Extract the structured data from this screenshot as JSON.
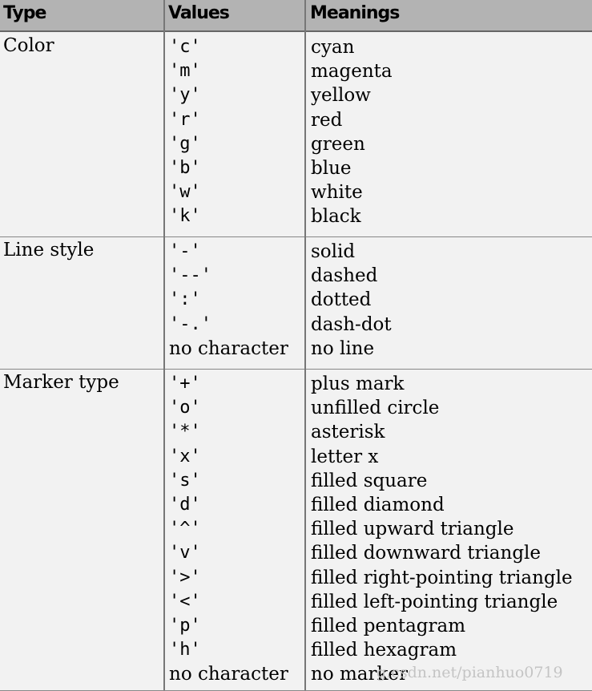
{
  "headers": {
    "type": "Type",
    "values": "Values",
    "meanings": "Meanings"
  },
  "sections": [
    {
      "type": "Color",
      "rows": [
        [
          "'c'",
          "cyan"
        ],
        [
          "'m'",
          "magenta"
        ],
        [
          "'y'",
          "yellow"
        ],
        [
          "'r'",
          "red"
        ],
        [
          "'g'",
          "green"
        ],
        [
          "'b'",
          "blue"
        ],
        [
          "'w'",
          "white"
        ],
        [
          "'k'",
          "black"
        ]
      ]
    },
    {
      "type": "Line style",
      "rows": [
        [
          "'-'",
          "solid"
        ],
        [
          "'--'",
          "dashed"
        ],
        [
          "':'",
          "dotted"
        ],
        [
          "'-.'",
          "dash-dot"
        ],
        [
          "no character",
          "no line"
        ]
      ]
    },
    {
      "type": "Marker type",
      "rows": [
        [
          "'+'",
          "plus mark"
        ],
        [
          "'o'",
          "unfilled circle"
        ],
        [
          "'*'",
          "asterisk"
        ],
        [
          "'x'",
          "letter x"
        ],
        [
          "'s'",
          "filled square"
        ],
        [
          "'d'",
          "filled diamond"
        ],
        [
          "'^'",
          "filled upward triangle"
        ],
        [
          "'v'",
          "filled downward triangle"
        ],
        [
          "'>'",
          "filled right-pointing triangle"
        ],
        [
          "'<'",
          "filled left-pointing triangle"
        ],
        [
          "'p'",
          "filled pentagram"
        ],
        [
          "'h'",
          "filled hexagram"
        ],
        [
          "no character",
          "no marker"
        ]
      ]
    }
  ],
  "watermark": "g.csdn.net/pianhuo0719"
}
